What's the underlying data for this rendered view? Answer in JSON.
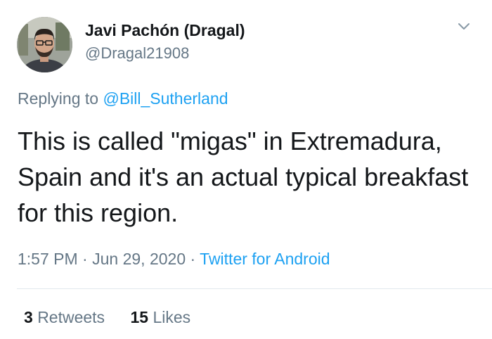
{
  "author": {
    "display_name": "Javi Pachón (Dragal)",
    "handle": "@Dragal21908",
    "avatar_icon": "user-avatar-photo"
  },
  "menu": {
    "icon": "chevron-down-icon"
  },
  "reply": {
    "prefix": "Replying to",
    "mention": "@Bill_Sutherland"
  },
  "tweet": {
    "text": "This is called \"migas\" in Extremadura, Spain and it's an actual typical breakfast for this region."
  },
  "meta": {
    "time": "1:57 PM",
    "separator": "·",
    "date": "Jun 29, 2020",
    "source": "Twitter for Android"
  },
  "stats": {
    "retweets_count": "3",
    "retweets_label": "Retweets",
    "likes_count": "15",
    "likes_label": "Likes"
  },
  "colors": {
    "text": "#14171a",
    "secondary": "#657786",
    "link": "#1da1f2",
    "divider": "#e1e8ed"
  }
}
